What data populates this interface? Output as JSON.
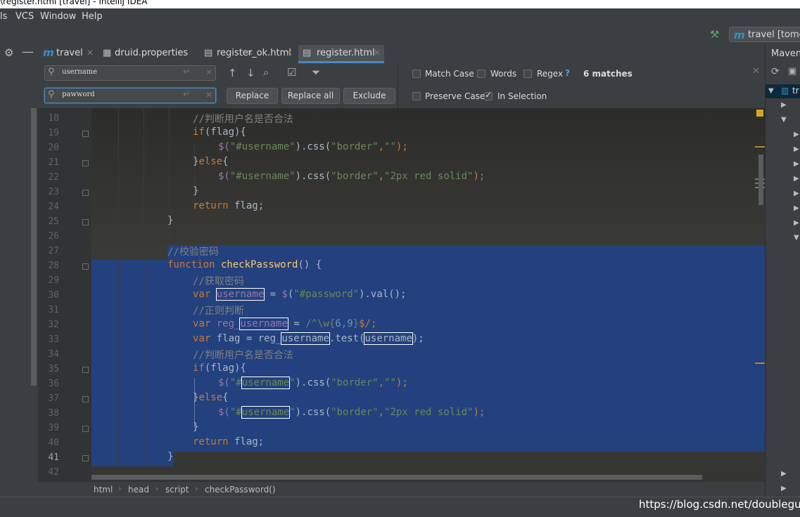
{
  "window": {
    "title": "\\register.html [travel] - IntelliJ IDEA"
  },
  "menu": {
    "items": [
      "ls",
      "VCS",
      "Window",
      "Help"
    ]
  },
  "navbar": {
    "run_config": "travel [tomcat"
  },
  "tabs": [
    {
      "label": "travel",
      "icon": "module-icon"
    },
    {
      "label": "druid.properties",
      "icon": "properties-file-icon"
    },
    {
      "label": "register_ok.html",
      "icon": "html-file-icon"
    },
    {
      "label": "register.html",
      "icon": "html-file-icon",
      "active": true
    }
  ],
  "find": {
    "search_value": "username",
    "replace_value": "pawword",
    "replace_label": "Replace",
    "replace_all_label": "Replace all",
    "exclude_label": "Exclude",
    "match_case": "Match Case",
    "words": "Words",
    "regex": "Regex",
    "regex_help": "?",
    "matches": "6 matches",
    "preserve_case": "Preserve Case",
    "in_selection": "In Selection",
    "in_selection_checked": true
  },
  "maven": {
    "title": "Maven",
    "root": "tr"
  },
  "editor": {
    "line_numbers": [
      "18",
      "19",
      "20",
      "21",
      "22",
      "23",
      "24",
      "25",
      "26",
      "27",
      "28",
      "29",
      "30",
      "31",
      "32",
      "33",
      "34",
      "35",
      "36",
      "37",
      "38",
      "39",
      "40",
      "41",
      "42"
    ],
    "selection_color": "#214283",
    "lines": {
      "l18": "//判断用户名是否合法",
      "l19_kw": "if",
      "l19_rest": "(flag){",
      "l20_a": "$(",
      "l20_b": "\"#username\"",
      "l20_c": ").css(",
      "l20_d": "\"border\"",
      "l20_e": ",",
      "l20_f": "\"\"",
      "l20_g": ");",
      "l21_a": "}",
      "l21_kw": "else",
      "l21_b": "{",
      "l22_a": "$(",
      "l22_b": "\"#username\"",
      "l22_c": ").css(",
      "l22_d": "\"border\"",
      "l22_e": ",",
      "l22_f": "\"2px red solid\"",
      "l22_g": ");",
      "l23": "}",
      "l24_kw": "return",
      "l24_rest": " flag;",
      "l25": "}",
      "l27": "//校验密码",
      "l28_kw": "function",
      "l28_fn": "checkPassword",
      "l28_rest": "() {",
      "l29": "//获取密码",
      "l30_kw": "var",
      "l30_id": "username",
      "l30_a": " = ",
      "l30_d": "$",
      "l30_b": "(",
      "l30_s": "\"#password\"",
      "l30_c": ").val();",
      "l31": "//正则判断",
      "l32_kw": "var",
      "l32_a": "reg_",
      "l32_id": "username",
      "l32_b": " = ",
      "l32_r1": "/^",
      "l32_r2": "\\w{",
      "l32_n": "6,9",
      "l32_r3": "}",
      "l32_r4": "$/",
      "l32_c": ";",
      "l33_kw": "var",
      "l33_a": " flag = reg_",
      "l33_id": "username",
      "l33_b": ".test(",
      "l33_id2": "username",
      "l33_c": ");",
      "l34": "//判断用户名是否合法",
      "l35_kw": "if",
      "l35_rest": "(flag){",
      "l36_a": "$(",
      "l36_q": "\"#",
      "l36_id": "username",
      "l36_q2": "\"",
      "l36_c": ").css(",
      "l36_d": "\"border\"",
      "l36_e": ",",
      "l36_f": "\"\"",
      "l36_g": ");",
      "l37_a": "}",
      "l37_kw": "else",
      "l37_b": "{",
      "l38_a": "$(",
      "l38_q": "\"#",
      "l38_id": "username",
      "l38_q2": "\"",
      "l38_c": ").css(",
      "l38_d": "\"border\"",
      "l38_e": ",",
      "l38_f": "\"2px red solid\"",
      "l38_g": ");",
      "l39": "}",
      "l40_kw": "return",
      "l40_rest": " flag;",
      "l41": "}"
    }
  },
  "breadcrumb": [
    "html",
    "head",
    "script",
    "checkPassword()"
  ],
  "watermark": "https://blog.csdn.net/doubleguy"
}
